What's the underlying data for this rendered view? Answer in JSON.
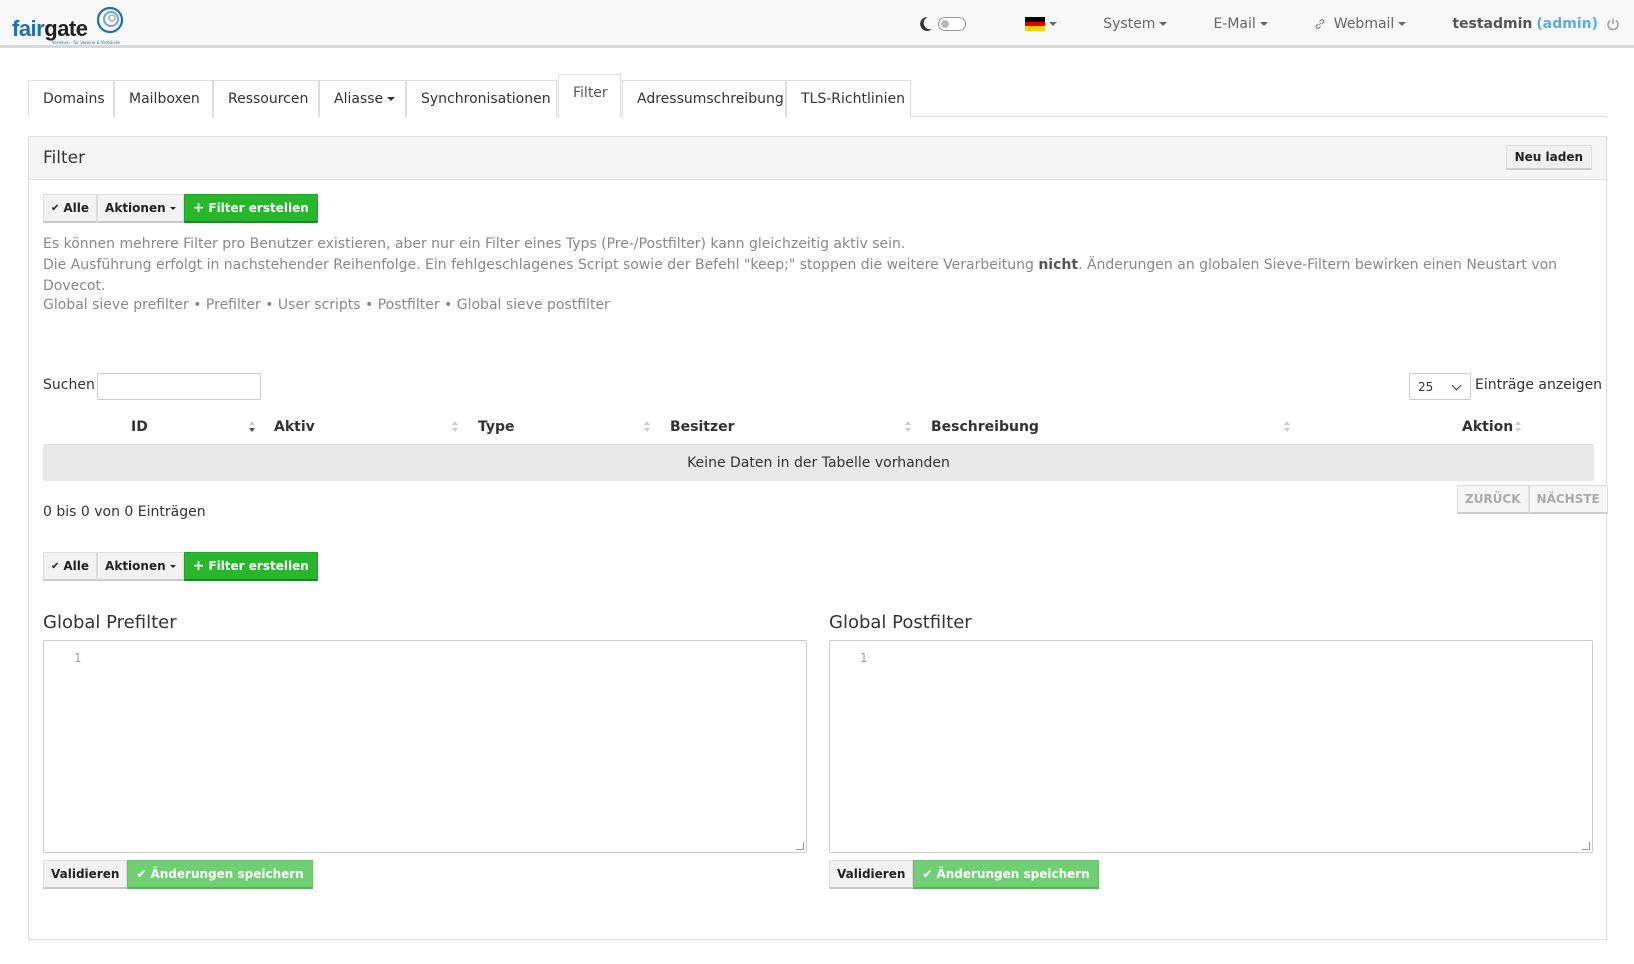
{
  "brand": {
    "name_part1": "fair",
    "name_part2": "gate",
    "tagline": "Vereinen · für Vereine & Verbände"
  },
  "navbar": {
    "menus": [
      {
        "label": "System"
      },
      {
        "label": "E-Mail"
      },
      {
        "label": "Webmail"
      }
    ],
    "user": {
      "name": "testadmin",
      "role": "(admin)"
    },
    "colors": {
      "accent": "#5aafe0",
      "brand": "#1d6fb8"
    }
  },
  "tabs": [
    {
      "label": "Domains"
    },
    {
      "label": "Mailboxen"
    },
    {
      "label": "Ressourcen"
    },
    {
      "label": "Aliasse"
    },
    {
      "label": "Synchronisationen"
    },
    {
      "label": "Filter"
    },
    {
      "label": "Adressumschreibung"
    },
    {
      "label": "TLS-Richtlinien"
    }
  ],
  "panel": {
    "title": "Filter",
    "reload_label": "Neu laden",
    "toolbar": {
      "all_label": "Alle",
      "actions_label": "Aktionen",
      "create_label": "Filter erstellen"
    },
    "info_line1": "Es können mehrere Filter pro Benutzer existieren, aber nur ein Filter eines Typs (Pre-/Postfilter) kann gleichzeitig aktiv sein.",
    "info_line2_pre": "Die Ausführung erfolgt in nachstehender Reihenfolge. Ein fehlgeschlagenes Script sowie der Befehl \"keep;\" stoppen die weitere Verarbeitung ",
    "info_line2_bold": "nicht",
    "info_line2_post": ". Änderungen an globalen Sieve-Filtern bewirken einen Neustart von Dovecot.",
    "order_line": "Global sieve prefilter • Prefilter • User scripts • Postfilter • Global sieve postfilter"
  },
  "table": {
    "search_label": "Suchen",
    "search_value": "",
    "page_length": "25",
    "page_length_label": "Einträge anzeigen",
    "columns": [
      "ID",
      "Aktiv",
      "Type",
      "Besitzer",
      "Beschreibung",
      "Aktion"
    ],
    "empty_text": "Keine Daten in der Tabelle vorhanden",
    "count_text": "0 bis 0 von 0 Einträgen",
    "prev_label": "ZURÜCK",
    "next_label": "NÄCHSTE"
  },
  "editors": {
    "prefilter": {
      "title": "Global Prefilter",
      "line": "1"
    },
    "postfilter": {
      "title": "Global Postfilter",
      "line": "1"
    },
    "validate_label": "Validieren",
    "save_label": "Änderungen speichern"
  }
}
